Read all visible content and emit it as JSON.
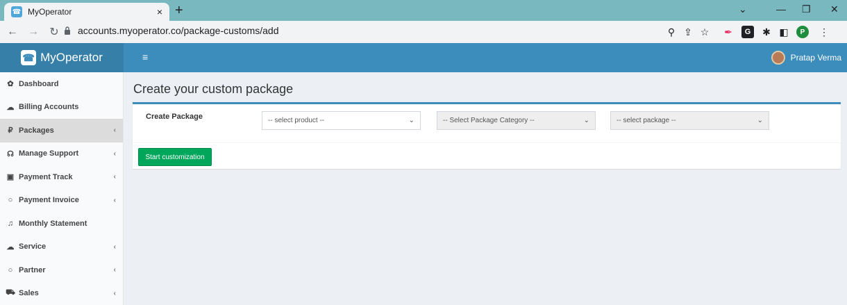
{
  "browser": {
    "tab_title": "MyOperator",
    "tab_close": "×",
    "new_tab": "+",
    "url": "accounts.myoperator.co/package-customs/add",
    "profile_initial": "P"
  },
  "header": {
    "brand": "MyOperator",
    "user_name": "Pratap Verma"
  },
  "sidebar": {
    "items": [
      {
        "label": "Dashboard",
        "icon": "tachometer-icon",
        "glyph": "✿",
        "chevron": ""
      },
      {
        "label": "Billing Accounts",
        "icon": "cloud-icon",
        "glyph": "☁",
        "chevron": ""
      },
      {
        "label": "Packages",
        "icon": "ruble-icon",
        "glyph": "₽",
        "chevron": "‹"
      },
      {
        "label": "Manage Support",
        "icon": "headset-icon",
        "glyph": "☊",
        "chevron": "‹"
      },
      {
        "label": "Payment Track",
        "icon": "money-icon",
        "glyph": "▣",
        "chevron": "‹"
      },
      {
        "label": "Payment Invoice",
        "icon": "circle-icon",
        "glyph": "○",
        "chevron": "‹"
      },
      {
        "label": "Monthly Statement",
        "icon": "bell-icon",
        "glyph": "♫",
        "chevron": ""
      },
      {
        "label": "Service",
        "icon": "cloud-service-icon",
        "glyph": "☁",
        "chevron": "‹"
      },
      {
        "label": "Partner",
        "icon": "circle-icon",
        "glyph": "○",
        "chevron": "‹"
      },
      {
        "label": "Sales",
        "icon": "cart-icon",
        "glyph": "⛟",
        "chevron": "‹"
      }
    ]
  },
  "main": {
    "title": "Create your custom package",
    "form_label": "Create Package",
    "product_select": "-- select product --",
    "category_select": "-- Select Package Category --",
    "package_select": "-- select package --",
    "start_button": "Start customization"
  },
  "colors": {
    "header": "#3c8dbc",
    "logo_bg": "#367fa9",
    "button_green": "#00a65a"
  }
}
